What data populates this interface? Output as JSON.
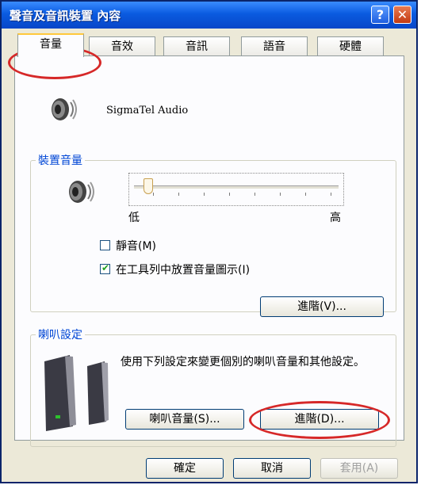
{
  "window": {
    "title": "聲音及音訊裝置 內容",
    "help_icon": "question-mark",
    "close_icon": "x"
  },
  "tabs": [
    {
      "label": "音量",
      "active": true
    },
    {
      "label": "音效",
      "active": false
    },
    {
      "label": "音訊",
      "active": false
    },
    {
      "label": "語音",
      "active": false
    },
    {
      "label": "硬體",
      "active": false
    }
  ],
  "device": {
    "icon": "speaker-icon",
    "name": "SigmaTel Audio"
  },
  "device_volume": {
    "legend": "裝置音量",
    "icon": "speaker-icon",
    "slider_level": 0.05,
    "low_label": "低",
    "high_label": "高",
    "mute": {
      "label": "靜音(M)",
      "checked": false
    },
    "show_icon": {
      "label": "在工具列中放置音量圖示(I)",
      "checked": true
    },
    "advanced_button": "進階(V)..."
  },
  "speaker_settings": {
    "legend": "喇叭設定",
    "icon": "speakers-icon",
    "description": "使用下列設定來變更個別的喇叭音量和其他設定。",
    "volume_button": "喇叭音量(S)...",
    "advanced_button": "進階(D)..."
  },
  "footer": {
    "ok": "確定",
    "cancel": "取消",
    "apply": "套用(A)"
  },
  "highlights": {
    "color": "#D62828"
  }
}
